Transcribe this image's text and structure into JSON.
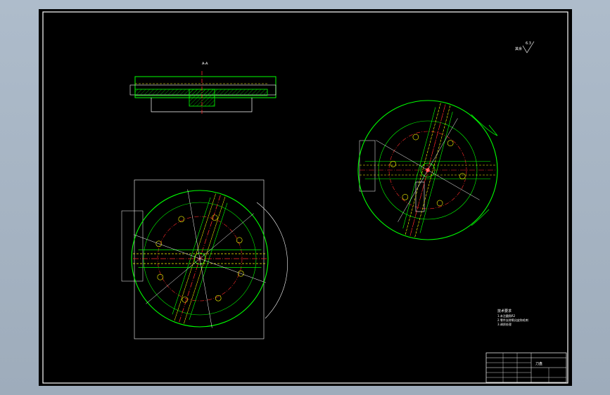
{
  "drawing": {
    "section_label": "A-A",
    "roughness_label": "6.3",
    "roughness_prefix": "其余",
    "notes_title": "技术要求",
    "notes_lines": [
      "1.未注圆角R2",
      "2.零件去除氧化皮和毛刺",
      "3.调质处理"
    ],
    "title_block": {
      "part_name": "刀盘",
      "drawing_no": "",
      "school": "",
      "scale": ""
    }
  },
  "colors": {
    "background": "#000000",
    "outline": "#00ff00",
    "center_line": "#ff2a2a",
    "hidden_line": "#ffff00",
    "text": "#ffffff",
    "frame": "#ffffff",
    "hatch": "#00ff00"
  }
}
